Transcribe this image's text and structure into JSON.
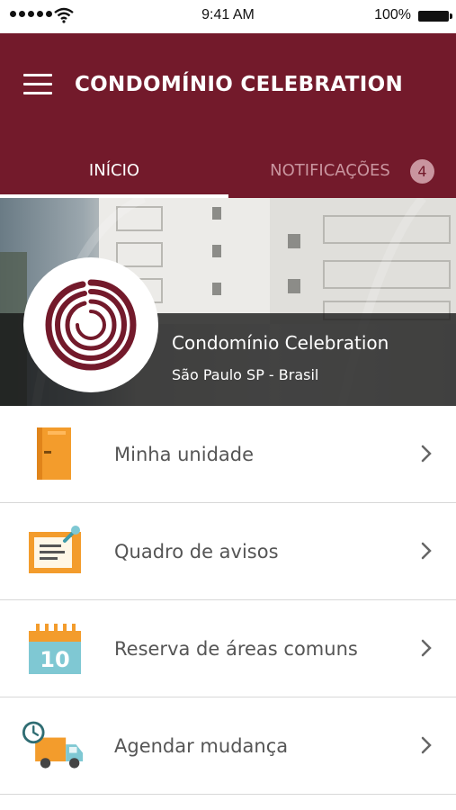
{
  "status_bar": {
    "time": "9:41 AM",
    "battery_percent": "100%"
  },
  "header": {
    "title": "CONDOMÍNIO CELEBRATION",
    "brand_color": "#731a2b"
  },
  "tabs": [
    {
      "label": "INÍCIO",
      "active": true
    },
    {
      "label": "NOTIFICAÇÕES",
      "active": false,
      "badge": "4"
    }
  ],
  "hero": {
    "name": "Condomínio Celebration",
    "location": "São Paulo SP - Brasil"
  },
  "menu": [
    {
      "label": "Minha unidade",
      "icon": "door-icon"
    },
    {
      "label": "Quadro de avisos",
      "icon": "notice-board-icon"
    },
    {
      "label": "Reserva de áreas comuns",
      "icon": "calendar-icon",
      "icon_text": "10"
    },
    {
      "label": "Agendar mudança",
      "icon": "moving-truck-icon"
    }
  ]
}
